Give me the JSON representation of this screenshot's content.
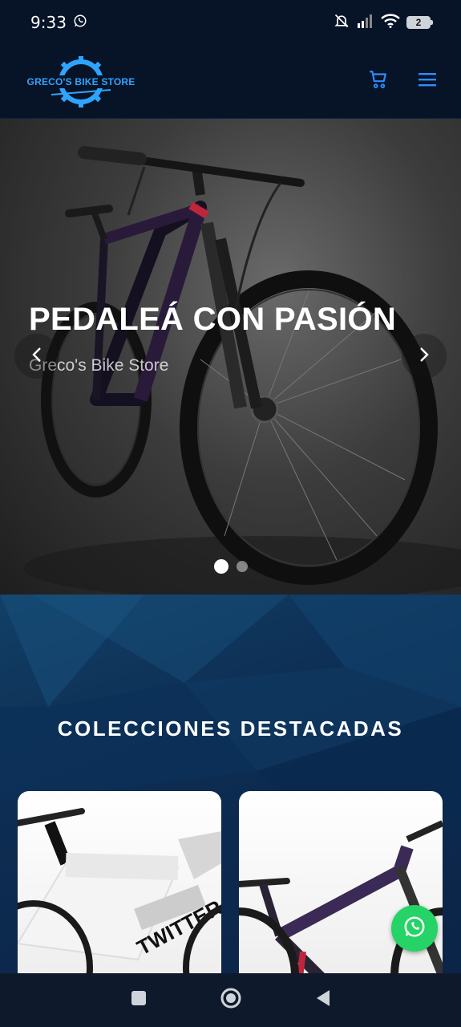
{
  "status_bar": {
    "time": "9:33",
    "notification_icon": "whatsapp-icon",
    "battery_level": "2",
    "icons": [
      "mute-icon",
      "signal-icon",
      "wifi-icon",
      "battery-icon"
    ]
  },
  "header": {
    "logo_text": "GRECO'S BIKE STORE",
    "logo_color": "#2fa4ff",
    "cart_icon": "cart-icon",
    "menu_icon": "hamburger-menu-icon",
    "accent_color": "#2f8cff"
  },
  "hero": {
    "title": "PEDALEÁ CON PASIÓN",
    "subtitle": "Greco's Bike Store",
    "prev_icon": "chevron-left-icon",
    "next_icon": "chevron-right-icon",
    "slides_count": 2,
    "active_slide": 1
  },
  "collections": {
    "title": "COLECCIONES DESTACADAS",
    "cards": [
      {
        "image": "white-road-bike-image"
      },
      {
        "image": "dark-mountain-bike-image"
      }
    ]
  },
  "whatsapp_button": {
    "icon": "whatsapp-icon",
    "color": "#25d366"
  },
  "nav_bar": {
    "items": [
      "recents-square-icon",
      "home-circle-icon",
      "back-triangle-icon"
    ]
  }
}
